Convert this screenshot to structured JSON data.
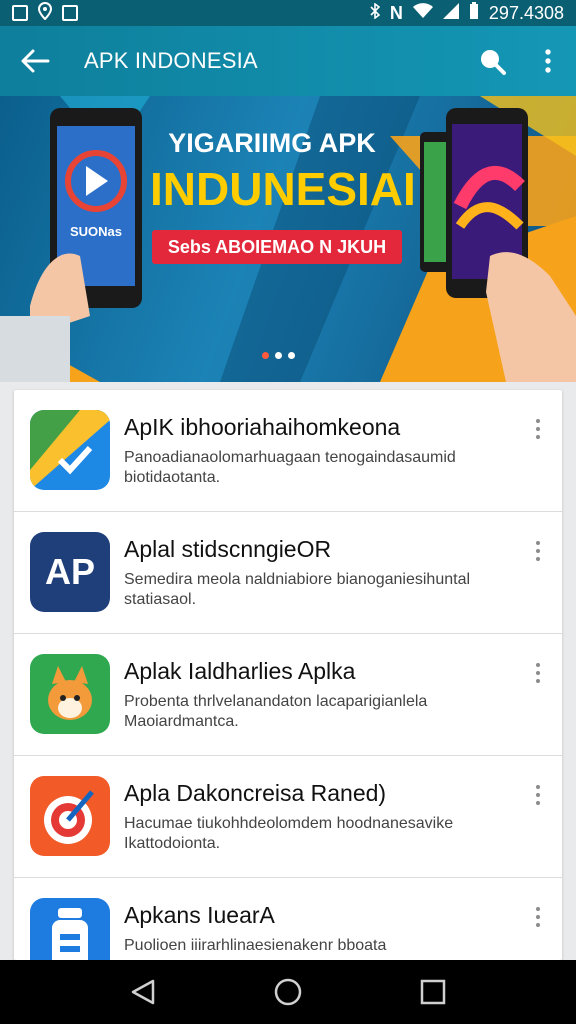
{
  "status_bar": {
    "time": "297.4308"
  },
  "app_bar": {
    "title": "APK INDONESIA"
  },
  "banner": {
    "line1": "YIGARIIMG APK",
    "line2": "INDUNESIAI",
    "button_label": "Sebs ABOIEMAO N JKUH",
    "phone_left_text": "SUONas"
  },
  "apps": [
    {
      "name": "ApIK ibhooriahaihomkeona",
      "desc": "Panoadianaolomarhuagaan tenogaindasaumid biotidaotanta.",
      "icon": "app-icon-1"
    },
    {
      "name": "Aplal stidscnngieOR",
      "desc": "Semedira meola naldniabiore bianoganiesihuntal statiasaol.",
      "icon": "app-icon-ap",
      "icon_text": "AP"
    },
    {
      "name": "Aplak Ialdharlies Aplka",
      "desc": "Probenta thrlvelanandaton lacaparigianlela Maoiardmantca.",
      "icon": "app-icon-fox"
    },
    {
      "name": "Apla Dakoncreisa Raned)",
      "desc": "Hacumae tiukohhdeolomdem hoodnanesavike Ikattodoionta.",
      "icon": "app-icon-target"
    },
    {
      "name": "Apkans IuearA",
      "desc": "Puolioen iiirarhlinaesienakenr bboata",
      "icon": "app-icon-bottle"
    }
  ],
  "colors": {
    "app_bar": "#1497b5",
    "status_bar": "#0b5f73",
    "banner_yellow": "#ffcc00",
    "banner_red": "#e3283c"
  }
}
